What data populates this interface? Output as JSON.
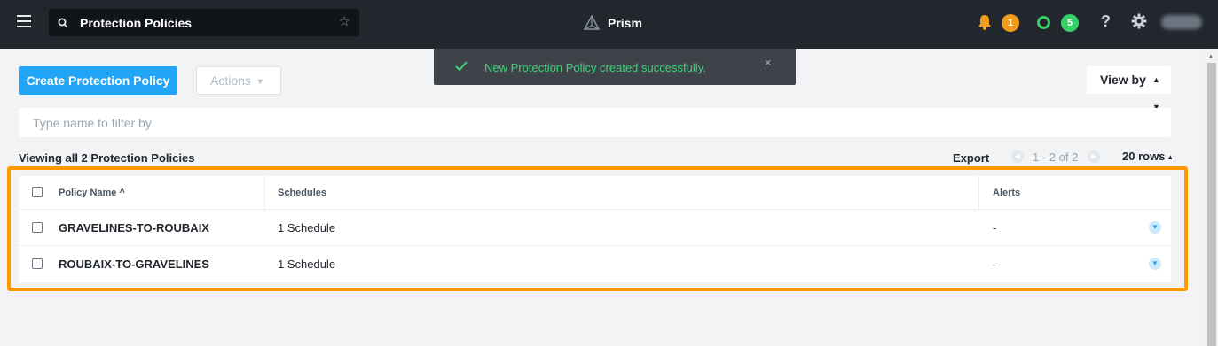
{
  "header": {
    "search_value": "Protection Policies",
    "brand": "Prism",
    "alerts_count": "1",
    "tasks_count": "5",
    "help_label": "?"
  },
  "toast": {
    "message": "New Protection Policy created successfully.",
    "close_label": "×"
  },
  "toolbar": {
    "create_label": "Create Protection Policy",
    "actions_label": "Actions",
    "view_by_label": "View by",
    "filter_placeholder": "Type name to filter by"
  },
  "list_info": {
    "summary": "Viewing all 2 Protection Policies",
    "export_label": "Export",
    "page_range": "1 - 2 of 2",
    "rows_label": "20 rows"
  },
  "table": {
    "columns": [
      "Policy Name",
      "Schedules",
      "Alerts"
    ],
    "sort_indicator": "^",
    "rows": [
      {
        "name": "GRAVELINES-TO-ROUBAIX",
        "schedules": "1 Schedule",
        "alerts": "-"
      },
      {
        "name": "ROUBAIX-TO-GRAVELINES",
        "schedules": "1 Schedule",
        "alerts": "-"
      }
    ]
  },
  "colors": {
    "topbar": "#22272e",
    "primary": "#22a5f7",
    "alert_badge": "#f29c1f",
    "task_badge": "#36d068",
    "toast_text": "#3fd37b",
    "highlight": "#ff9900"
  }
}
